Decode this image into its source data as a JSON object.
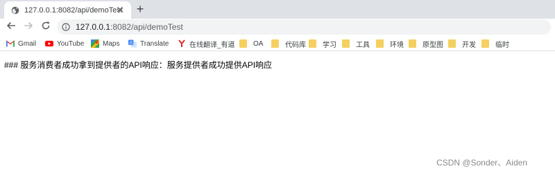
{
  "tab": {
    "title": "127.0.0.1:8082/api/demoTest",
    "close_glyph": "✕",
    "new_tab_glyph": "+",
    "favicon": "globe-icon"
  },
  "toolbar": {
    "back_icon": "arrow-left-icon",
    "forward_icon": "arrow-right-icon",
    "reload_icon": "reload-icon",
    "url_host": "127.0.0.1",
    "url_rest": ":8082/api/demoTest"
  },
  "bookmarks": [
    {
      "label": "Gmail",
      "icon": "gmail-icon"
    },
    {
      "label": "YouTube",
      "icon": "youtube-icon"
    },
    {
      "label": "Maps",
      "icon": "maps-icon"
    },
    {
      "label": "Translate",
      "icon": "translate-icon"
    },
    {
      "label": "在线翻译_有道",
      "icon": "youdao-icon"
    },
    {
      "label": "OA",
      "icon": "folder-icon"
    },
    {
      "label": "代码库",
      "icon": "folder-icon"
    },
    {
      "label": "学习",
      "icon": "folder-icon"
    },
    {
      "label": "工具",
      "icon": "folder-icon"
    },
    {
      "label": "环境",
      "icon": "folder-icon"
    },
    {
      "label": "原型图",
      "icon": "folder-icon"
    },
    {
      "label": "开发",
      "icon": "folder-icon"
    },
    {
      "label": "临时",
      "icon": "folder-icon"
    }
  ],
  "page": {
    "body_text": "### 服务消费者成功拿到提供者的API响应：服务提供者成功提供API响应"
  },
  "watermark": "CSDN @Sonder、Aiden",
  "colors": {
    "tabstrip_bg": "#dee1e6",
    "omnibox_bg": "#f1f3f4",
    "folder": "#f5d060",
    "youtube_red": "#ff0000",
    "gmail_red": "#ea4335"
  }
}
